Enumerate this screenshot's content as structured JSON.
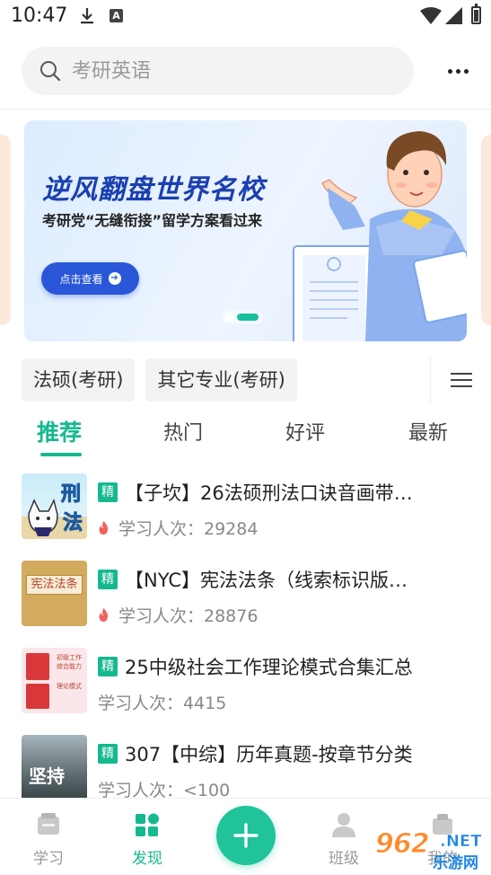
{
  "status_bar": {
    "time": "10:47",
    "a_icon": "A"
  },
  "search": {
    "placeholder": "考研英语"
  },
  "banner": {
    "title": "逆风翻盘世界名校",
    "subtitle": "考研党“无缝衔接”留学方案看过来",
    "cta": "点击查看",
    "page_indicator": {
      "count": 2,
      "active_index": 1
    }
  },
  "categories": [
    "法硕(考研)",
    "其它专业(考研)"
  ],
  "tabs": [
    {
      "label": "推荐",
      "active": true
    },
    {
      "label": "热门",
      "active": false
    },
    {
      "label": "好评",
      "active": false
    },
    {
      "label": "最新",
      "active": false
    }
  ],
  "list": {
    "badge": "精",
    "items": [
      {
        "title": "【子坎】26法硕刑法口诀音画带…",
        "meta": "学习人次：29284",
        "hot": true,
        "thumb_text": [
          "刑",
          "法"
        ]
      },
      {
        "title": "【NYC】宪法法条（线索标识版…",
        "meta": "学习人次：28876",
        "hot": true,
        "thumb_text": [
          "宪法法条"
        ]
      },
      {
        "title": "25中级社会工作理论模式合集汇总",
        "meta": "学习人次：4415",
        "hot": false,
        "thumb_text": [
          "初级工作",
          "综合能力",
          "理论模式"
        ]
      },
      {
        "title": "307【中综】历年真题-按章节分类",
        "meta": "学习人次：<100",
        "hot": false,
        "thumb_text": [
          "坚持"
        ]
      }
    ]
  },
  "bottom_nav": {
    "items": [
      {
        "label": "学习",
        "icon": "book-icon",
        "active": false
      },
      {
        "label": "发现",
        "icon": "discover-icon",
        "active": true
      },
      {
        "label": "班级",
        "icon": "class-icon",
        "active": false
      },
      {
        "label": "我的",
        "icon": "profile-icon",
        "active": false
      }
    ],
    "fab_icon": "plus-icon"
  },
  "watermark": {
    "number": "962",
    "net": ".NET",
    "cn": "乐游网"
  },
  "colors": {
    "accent": "#16b98f",
    "banner_title": "#1a3fb0",
    "cta": "#2957d8",
    "watermark_orange": "#ff8a2a"
  }
}
